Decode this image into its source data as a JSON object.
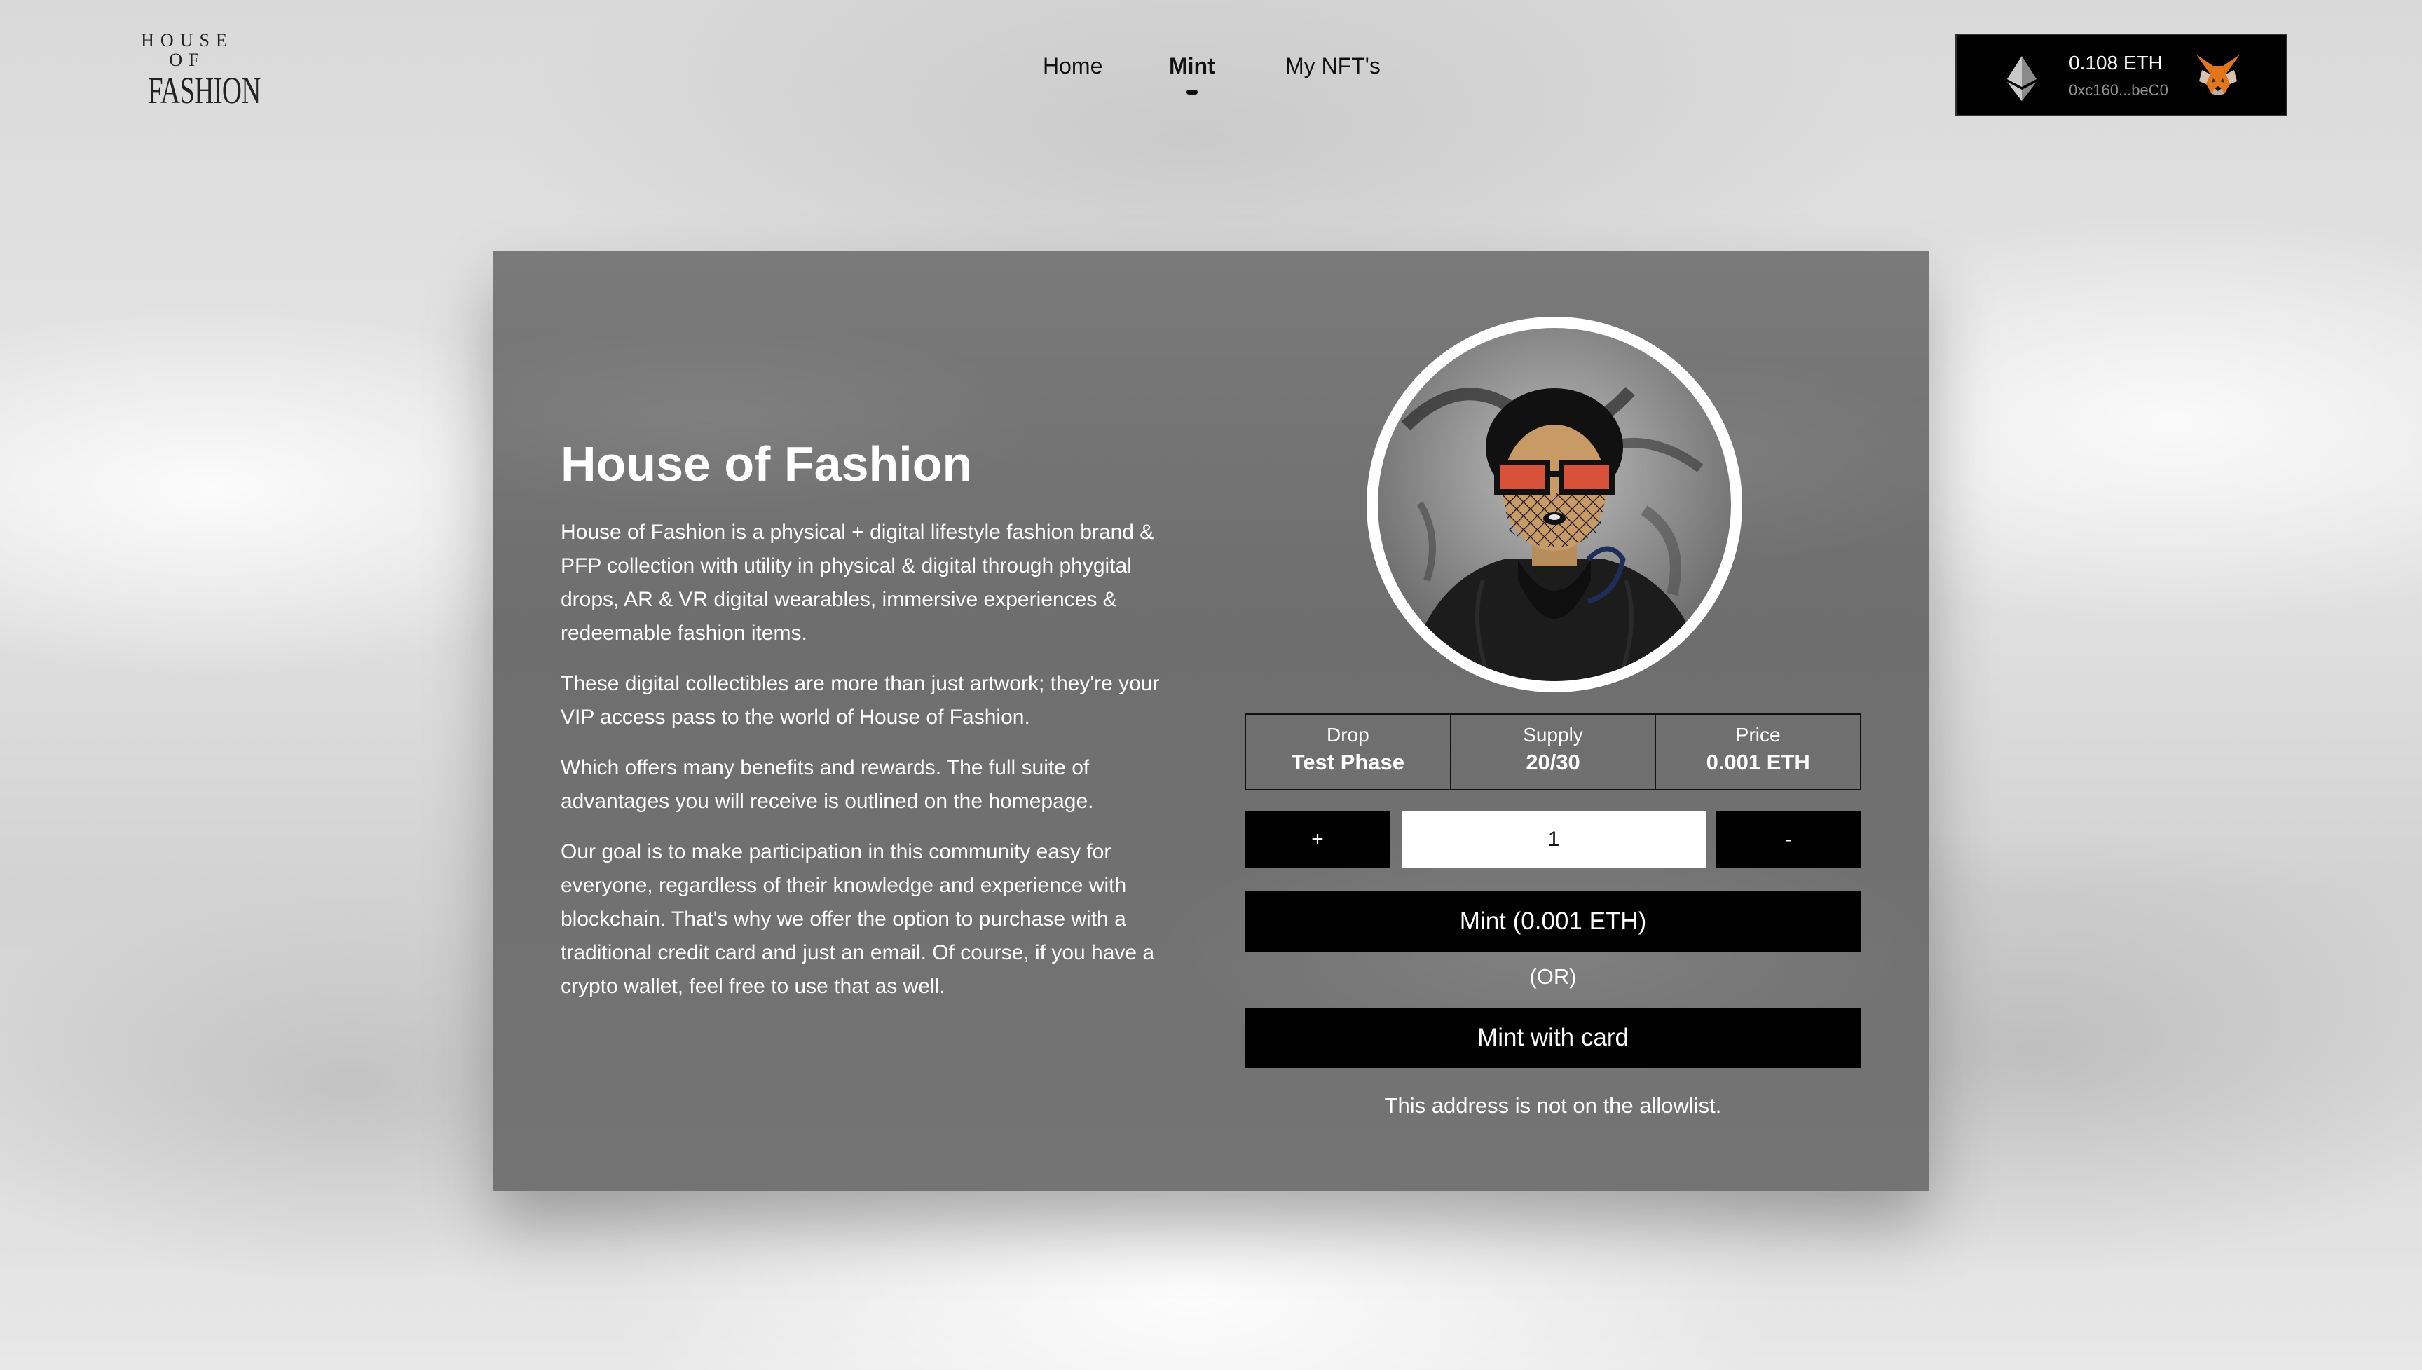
{
  "logo": {
    "top": "HOUSE OF",
    "bottom": "FASHION"
  },
  "nav": {
    "items": [
      {
        "label": "Home",
        "active": false
      },
      {
        "label": "Mint",
        "active": true
      },
      {
        "label": "My NFT's",
        "active": false
      }
    ]
  },
  "wallet": {
    "balance": "0.108 ETH",
    "address": "0xc160...beC0",
    "currency_icon": "ethereum-icon",
    "provider_icon": "metamask-fox-icon"
  },
  "collection": {
    "title": "House of Fashion",
    "paragraphs": [
      "House of Fashion is a physical + digital lifestyle fashion brand & PFP collection with utility in physical & digital through phygital drops, AR & VR digital wearables, immersive experiences & redeemable fashion items.",
      "These digital collectibles are more than just artwork; they're your VIP access pass to the world of House of Fashion.",
      "Which offers many benefits and rewards. The full suite of advantages you will receive is outlined on the homepage.",
      "Our goal is to make participation in this community easy for everyone, regardless of their knowledge and experience with blockchain. That's why we offer the option to purchase with a traditional credit card and just an email. Of course, if you have a crypto wallet, feel free to use that as well."
    ]
  },
  "stats": {
    "drop": {
      "label": "Drop",
      "value": "Test Phase"
    },
    "supply": {
      "label": "Supply",
      "value": "20/30"
    },
    "price": {
      "label": "Price",
      "value": "0.001 ETH"
    }
  },
  "quantity": {
    "increment_label": "+",
    "decrement_label": "-",
    "value": "1"
  },
  "mint": {
    "primary_label": "Mint (0.001 ETH)",
    "or_label": "(OR)",
    "card_label": "Mint with card",
    "status": "This address is not on the allowlist."
  }
}
